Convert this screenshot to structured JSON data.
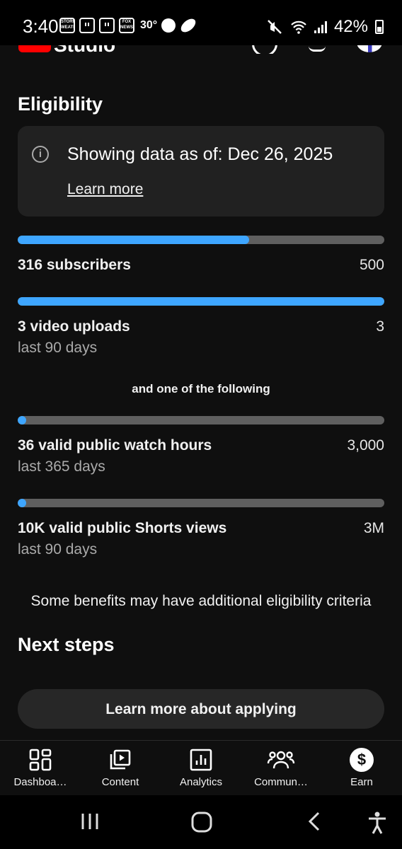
{
  "status_bar": {
    "time": "3:40",
    "temperature": "30°",
    "battery": "42%",
    "icons": [
      "storm-weather-icon",
      "twitch-icon",
      "twitch-icon",
      "fox-news-icon",
      "android-auto-icon",
      "football-icon",
      "mute-icon",
      "wifi-icon",
      "signal-icon",
      "battery-icon"
    ],
    "mini_labels": {
      "weather": "STORM WEATHER",
      "fox": "FOX NEWS"
    }
  },
  "header": {
    "app_title": "Studio"
  },
  "eligibility": {
    "title": "Eligibility",
    "info": {
      "icon": "info-icon",
      "text": "Showing data as of: Dec 26, 2025",
      "link": "Learn more"
    },
    "requirements": [
      {
        "label": "316 subscribers",
        "target": "500",
        "progress": 0.632
      },
      {
        "label": "3 video uploads",
        "sub": "last 90 days",
        "target": "3",
        "progress": 1.0
      }
    ],
    "alternative_heading": "and one of the following",
    "alternatives": [
      {
        "label": "36 valid public watch hours",
        "sub": "last 365 days",
        "target": "3,000",
        "progress": 0.012
      },
      {
        "label": "10K valid public Shorts views",
        "sub": "last 90 days",
        "target": "3M",
        "progress": 0.0033
      }
    ],
    "note": "Some benefits may have additional eligibility criteria"
  },
  "next_steps": {
    "title": "Next steps",
    "button": "Learn more about applying"
  },
  "bottom_nav": [
    {
      "label": "Dashboa…",
      "icon": "dashboard-icon"
    },
    {
      "label": "Content",
      "icon": "content-icon"
    },
    {
      "label": "Analytics",
      "icon": "analytics-icon"
    },
    {
      "label": "Commun…",
      "icon": "community-icon"
    },
    {
      "label": "Earn",
      "icon": "earn-icon",
      "active": true
    }
  ],
  "system_nav": [
    "recents-icon",
    "home-icon",
    "back-icon",
    "accessibility-icon"
  ],
  "colors": {
    "background": "#0f0f0f",
    "progress_fill": "#3ea6ff",
    "progress_track": "#5f5f5f",
    "card": "#212121"
  }
}
